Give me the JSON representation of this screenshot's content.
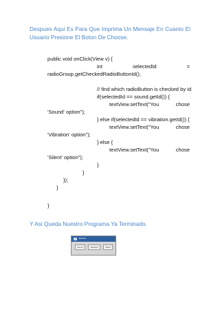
{
  "intro": {
    "line1": "Despues Aqui Es Para Que Imprima Un Mensaje En Cuanto El",
    "line2": "Usuario Presione El Boton De Choose."
  },
  "code": {
    "l1": "public void onClick(View v) {",
    "l2a": "int",
    "l2b": "selectedId",
    "l2c": "=",
    "l3": "radioGroup.getCheckedRadioButtonId();",
    "l4": "// find which radioButton is checked by id",
    "l5": "if(selectedId == sound.getId()) {",
    "l6a": "textView.setText(\"You",
    "l6b": "chose",
    "l7": "'Sound' option\");",
    "l8": "} else if(selectedId == vibration.getId()) {",
    "l9a": "textView.setText(\"You",
    "l9b": "chose",
    "l10": "'Vibration' option\");",
    "l11": "} else {",
    "l12a": "textView.setText(\"You",
    "l12b": "chose",
    "l13": "'Silent' option\");",
    "l14": "}",
    "l15": "}",
    "l16": "});",
    "l17": "}",
    "l18": "}"
  },
  "outro": "Y Asi Queda Nuestro Programa Ya Terminado.",
  "screenshot": {
    "app_title": "RadioG",
    "options": [
      "Sound",
      "Vibration",
      "Silent"
    ]
  }
}
